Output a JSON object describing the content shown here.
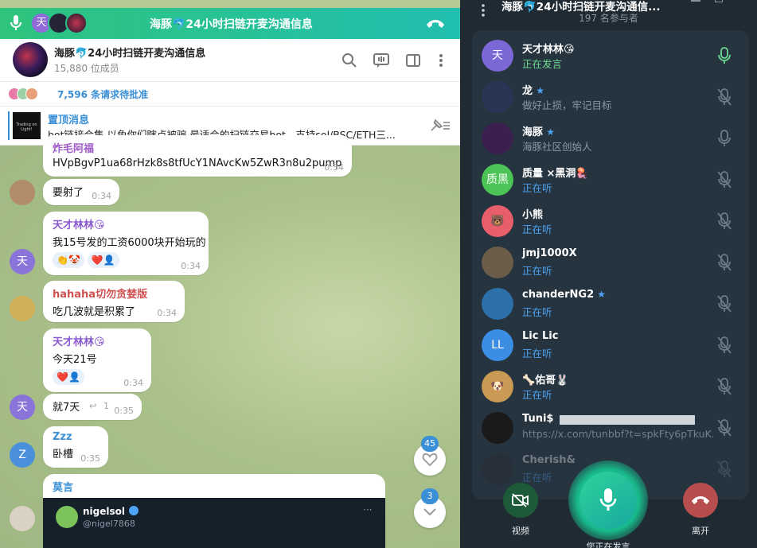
{
  "call_bar": {
    "title": "海豚🐬24小时扫链开麦沟通信息",
    "avatar_letter": "天"
  },
  "chat": {
    "name": "海豚🐬24小时扫链开麦沟通信息",
    "members": "15,880 位成员",
    "join_requests": "7,596 条请求待批准",
    "pinned_label": "置顶消息",
    "pinned_text": "bot链接合集 以免你们瞎点被骗   最适合的扫链交易bot，支持sol/BSC/ETH三...",
    "pinned_thumb_text": "Trading on Light!"
  },
  "messages": [
    {
      "sender": "炸毛阿福",
      "text": "HVpBgvP1ua68rHzk8s8tfUcY1NAvcKw5ZwR3n8u2pump",
      "time": "0:34"
    },
    {
      "text": "要射了",
      "time": "0:34"
    },
    {
      "sender": "天才林林😘",
      "text": "我15号发的工资6000块开始玩的",
      "time": "0:34",
      "reactions": [
        "👏🤡",
        "❤️👤"
      ],
      "avatar": "天"
    },
    {
      "sender": "hahaha切勿贪婪版",
      "text": "吃几波就是积累了",
      "time": "0:34"
    },
    {
      "sender": "天才林林😘",
      "text": "今天21号",
      "time": "0:34",
      "reactions": [
        "❤️👤"
      ]
    },
    {
      "text": "就7天",
      "time": "0:35",
      "reply_count": "1",
      "avatar": "天"
    },
    {
      "sender": "Zzz",
      "text": "卧槽",
      "time": "0:35",
      "avatar": "Z"
    },
    {
      "sender": "莫言",
      "embed_name": "nigelsol",
      "embed_handle": "@nigel7868"
    }
  ],
  "floating": {
    "like_count": "45",
    "down_count": "3"
  },
  "voice_chat": {
    "title": "海豚🐬24小时扫链开麦沟通信...",
    "participants_count": "197 名参与者",
    "participants": [
      {
        "name": "天才林林😘",
        "status": "正在发言",
        "avatar": "天",
        "color": "#7b68d6",
        "state": "speaking",
        "star": false
      },
      {
        "name": "龙",
        "status": "做好止损，牢记目标",
        "avatar": "",
        "color": "#2a3556",
        "state": "muted",
        "star": true
      },
      {
        "name": "海豚",
        "status": "海豚社区创始人",
        "avatar": "",
        "color": "#3b1f4f",
        "state": "mic",
        "star": true
      },
      {
        "name": "质量 ×黑洞🪼",
        "status": "正在听",
        "avatar": "质黑",
        "color": "#4cc456",
        "state": "muted",
        "star": false
      },
      {
        "name": "小熊",
        "status": "正在听",
        "avatar": "🐻",
        "color": "#e85e6b",
        "state": "muted",
        "star": false
      },
      {
        "name": "jmj1000X",
        "status": "正在听",
        "avatar": "",
        "color": "#6b5d4a",
        "state": "muted",
        "star": false
      },
      {
        "name": "chanderNG2",
        "status": "正在听",
        "avatar": "",
        "color": "#2d6fa8",
        "state": "muted",
        "star": true
      },
      {
        "name": "Lic Lic",
        "status": "正在听",
        "avatar": "LL",
        "color": "#3b8ee3",
        "state": "muted",
        "star": false
      },
      {
        "name": "🦴佑哥🐰",
        "status": "正在听",
        "avatar": "🐶",
        "color": "#c99a53",
        "state": "muted",
        "star": false
      },
      {
        "name": "Tuni$",
        "status": "https://x.com/tunbbf?t=spkFty6pTkuK...",
        "avatar": "",
        "color": "#1a1a1a",
        "state": "muted",
        "star": false,
        "link": true
      },
      {
        "name": "Cherish&",
        "status": "正在听",
        "avatar": "",
        "color": "#2a2a2a",
        "state": "muted",
        "star": false,
        "faded": true
      }
    ],
    "video_label": "视频",
    "leave_label": "离开",
    "speaking_label": "您正在发言"
  },
  "colors": {
    "accent": "#3a8fd6",
    "speaking": "#6fdc91",
    "listening": "#4ea4f6",
    "call_green": "#2fc47c",
    "leave": "#c84b4b"
  }
}
